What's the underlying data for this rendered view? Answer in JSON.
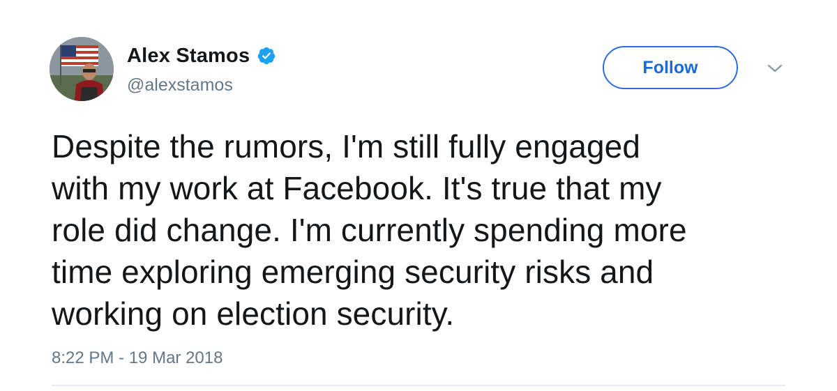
{
  "tweet": {
    "author": {
      "display_name": "Alex Stamos",
      "handle": "@alexstamos",
      "verified": true,
      "avatar_icon": "profile-photo"
    },
    "follow_label": "Follow",
    "menu_icon": "chevron-down-icon",
    "text": "Despite the rumors, I'm still fully engaged\nwith my work at Facebook. It's true that my\nrole did change. I'm currently spending more\ntime exploring emerging security risks and\nworking on election security.",
    "timestamp": "8:22 PM - 19 Mar 2018"
  },
  "colors": {
    "accent": "#1da1f2",
    "follow_text": "#1a6ad9",
    "secondary_text": "#657786",
    "primary_text": "#14171a",
    "divider": "#e6ecf0"
  }
}
